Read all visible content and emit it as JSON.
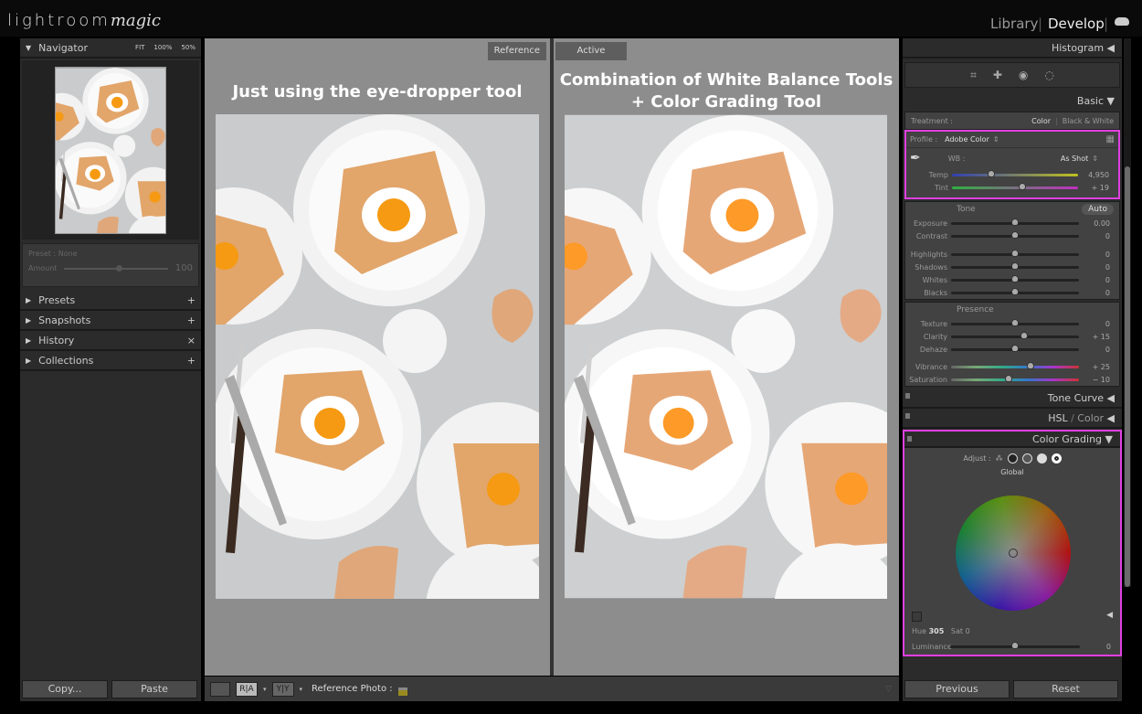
{
  "app": {
    "logo": "lightroom",
    "logo_script": "magic",
    "modules": [
      "Library",
      "Develop"
    ],
    "active_module": "Develop",
    "cloud_icon": "cloud-icon"
  },
  "navigator": {
    "title": "Navigator",
    "zoom": [
      "FIT",
      "100%",
      "50%"
    ]
  },
  "preset": {
    "label": "Preset : None",
    "amount_label": "Amount",
    "amount_value": "100",
    "amount_fraction": 0.5
  },
  "left_panels": [
    {
      "label": "Presets",
      "action": "+"
    },
    {
      "label": "Snapshots",
      "action": "+"
    },
    {
      "label": "History",
      "action": "×"
    },
    {
      "label": "Collections",
      "action": "+"
    }
  ],
  "left_buttons": {
    "copy": "Copy...",
    "paste": "Paste"
  },
  "reference": {
    "tag": "Reference",
    "caption": "Just using the eye-dropper tool"
  },
  "active": {
    "tag": "Active",
    "caption_line1": "Combination of White Balance Tools",
    "caption_line2": "+ Color Grading Tool"
  },
  "toolbar": {
    "view1": "",
    "ra": "R|A",
    "yy": "Y|Y",
    "ref_label": "Reference Photo :"
  },
  "right": {
    "histogram": "Histogram",
    "basic": "Basic",
    "treatment_label": "Treatment :",
    "treatment_color": "Color",
    "treatment_bw": "Black & White",
    "profile_label": "Profile :",
    "profile_value": "Adobe Color",
    "wb_label": "WB :",
    "wb_value": "As Shot",
    "wb_sliders": [
      {
        "label": "Temp",
        "value": "4,950",
        "pos": 0.31
      },
      {
        "label": "Tint",
        "value": "+ 19",
        "pos": 0.56
      }
    ],
    "tone_label": "Tone",
    "auto": "Auto",
    "tone_sliders": [
      {
        "label": "Exposure",
        "value": "0.00",
        "pos": 0.5
      },
      {
        "label": "Contrast",
        "value": "0",
        "pos": 0.5
      }
    ],
    "tone_sliders2": [
      {
        "label": "Highlights",
        "value": "0",
        "pos": 0.5
      },
      {
        "label": "Shadows",
        "value": "0",
        "pos": 0.5
      },
      {
        "label": "Whites",
        "value": "0",
        "pos": 0.5
      },
      {
        "label": "Blacks",
        "value": "0",
        "pos": 0.5
      }
    ],
    "presence_label": "Presence",
    "presence_sliders": [
      {
        "label": "Texture",
        "value": "0",
        "pos": 0.5
      },
      {
        "label": "Clarity",
        "value": "+ 15",
        "pos": 0.57
      },
      {
        "label": "Dehaze",
        "value": "0",
        "pos": 0.5
      }
    ],
    "color_sliders": [
      {
        "label": "Vibrance",
        "value": "+ 25",
        "pos": 0.62
      },
      {
        "label": "Saturation",
        "value": "− 10",
        "pos": 0.45
      }
    ],
    "tone_curve": "Tone Curve",
    "hsl": "HSL",
    "hsl_color": "Color",
    "color_grading": "Color Grading",
    "adjust_label": "Adjust :",
    "global": "Global",
    "hue_label": "Hue",
    "hue_value": "305",
    "sat_label": "Sat",
    "sat_value": "0",
    "luminance_label": "Luminance",
    "luminance_value": "0",
    "luminance_pos": 0.5,
    "previous": "Previous",
    "reset": "Reset",
    "highlight_color": "#e040e0"
  }
}
